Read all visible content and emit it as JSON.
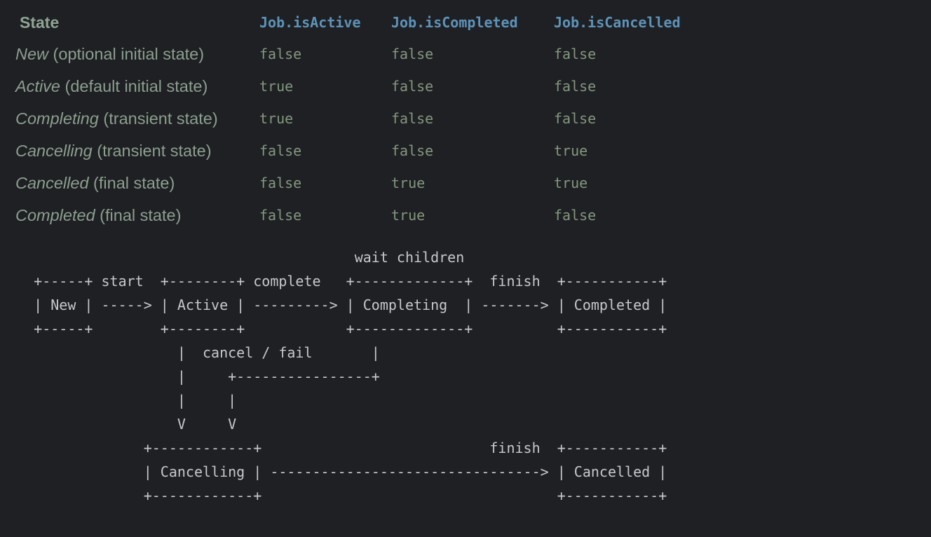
{
  "table": {
    "headers": {
      "state": "State",
      "is_active": "Job.isActive",
      "is_completed": "Job.isCompleted",
      "is_cancelled": "Job.isCancelled"
    },
    "rows": [
      {
        "name": "New",
        "note": " (optional initial state)",
        "is_active": "false",
        "is_completed": "false",
        "is_cancelled": "false"
      },
      {
        "name": "Active",
        "note": " (default initial state)",
        "is_active": "true",
        "is_completed": "false",
        "is_cancelled": "false"
      },
      {
        "name": "Completing",
        "note": " (transient state)",
        "is_active": "true",
        "is_completed": "false",
        "is_cancelled": "false"
      },
      {
        "name": "Cancelling",
        "note": " (transient state)",
        "is_active": "false",
        "is_completed": "false",
        "is_cancelled": "true"
      },
      {
        "name": "Cancelled",
        "note": " (final state)",
        "is_active": "false",
        "is_completed": "true",
        "is_cancelled": "true"
      },
      {
        "name": "Completed",
        "note": " (final state)",
        "is_active": "false",
        "is_completed": "true",
        "is_cancelled": "false"
      }
    ]
  },
  "diagram": {
    "text": "                                          wait children\n    +-----+ start  +--------+ complete   +-------------+  finish  +-----------+\n    | New | -----> | Active | ---------> | Completing  | -------> | Completed |\n    +-----+        +--------+            +-------------+          +-----------+\n                     |  cancel / fail       |\n                     |     +----------------+\n                     |     |\n                     V     V\n                 +------------+                           finish  +-----------+\n                 | Cancelling | --------------------------------> | Cancelled |\n                 +------------+                                   +-----------+"
  },
  "colors": {
    "background": "#1f2023",
    "header_state": "#8fa495",
    "header_code": "#5d93ba",
    "state_text": "#8c9f90",
    "value_text": "#84977f",
    "diagram_text": "#c8c8cc"
  }
}
